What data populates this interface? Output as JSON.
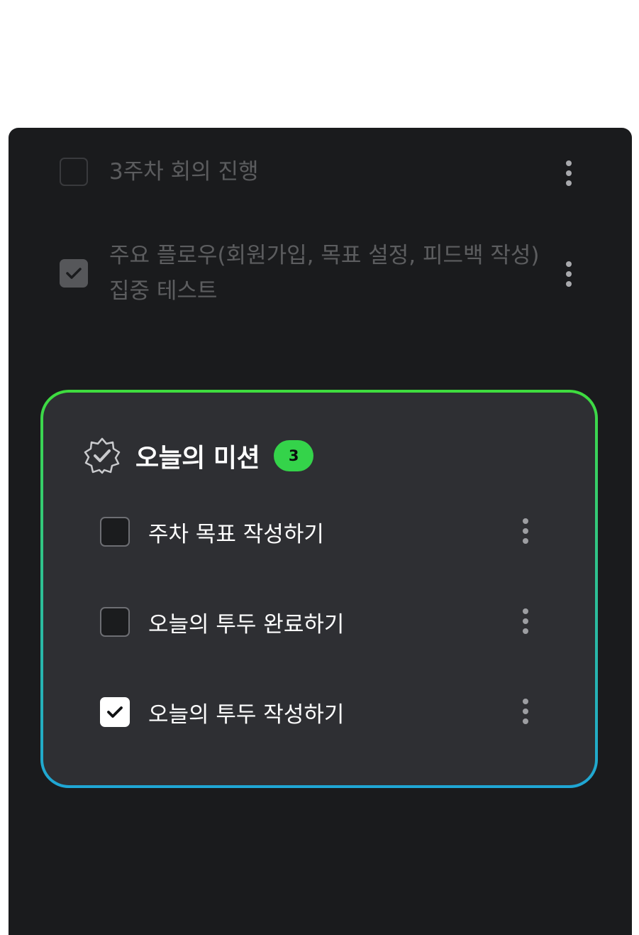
{
  "todos": [
    {
      "label": "3주차 회의 진행",
      "checked": false
    },
    {
      "label": "주요 플로우(회원가입, 목표 설정, 피드백 작성) 집중 테스트",
      "checked": true
    }
  ],
  "mission": {
    "title": "오늘의 미션",
    "count": "3",
    "icon": "verified-badge-icon",
    "items": [
      {
        "label": "주차 목표 작성하기",
        "checked": false
      },
      {
        "label": "오늘의 투두 완료하기",
        "checked": false
      },
      {
        "label": "오늘의 투두 작성하기",
        "checked": true
      }
    ]
  },
  "colors": {
    "panel_bg": "#1a1b1d",
    "card_bg": "#2e2f33",
    "border_gradient_top": "#3fdc3e",
    "border_gradient_bottom": "#1fa6d5",
    "badge": "#34d34a"
  }
}
